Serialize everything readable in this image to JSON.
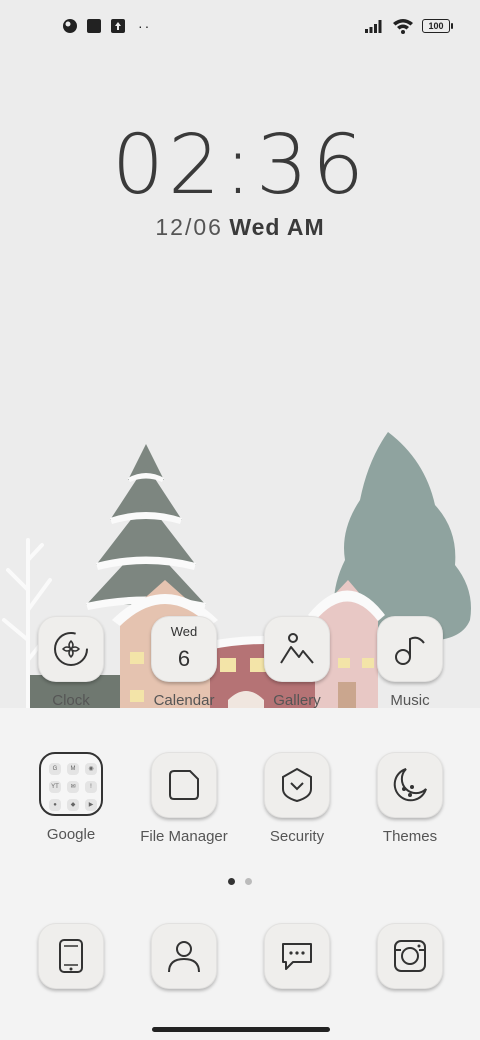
{
  "status_bar": {
    "left_icons": [
      "notification-icon",
      "app-notification-icon",
      "upload-icon"
    ],
    "more_dots": "··",
    "battery": "100"
  },
  "lockclock": {
    "time": "02:36",
    "date": "12/06",
    "weekday": "Wed",
    "ampm": "AM"
  },
  "apps_row1": [
    {
      "label": "Clock",
      "icon": "clock-icon"
    },
    {
      "label": "Calendar",
      "icon": "calendar-icon",
      "day": "Wed",
      "date": "6"
    },
    {
      "label": "Gallery",
      "icon": "gallery-icon"
    },
    {
      "label": "Music",
      "icon": "music-icon"
    }
  ],
  "apps_row2": [
    {
      "label": "Google",
      "icon": "google-folder-icon"
    },
    {
      "label": "File Manager",
      "icon": "file-manager-icon"
    },
    {
      "label": "Security",
      "icon": "security-icon"
    },
    {
      "label": "Themes",
      "icon": "themes-icon"
    }
  ],
  "google_folder_items": [
    "G",
    "M",
    "◉",
    "YT",
    "✉",
    "!",
    "●",
    "◆",
    "▶"
  ],
  "dock": [
    {
      "icon": "phone-icon"
    },
    {
      "icon": "contacts-icon"
    },
    {
      "icon": "messages-icon"
    },
    {
      "icon": "camera-icon"
    }
  ],
  "pager": {
    "pages": 2,
    "active": 0
  }
}
